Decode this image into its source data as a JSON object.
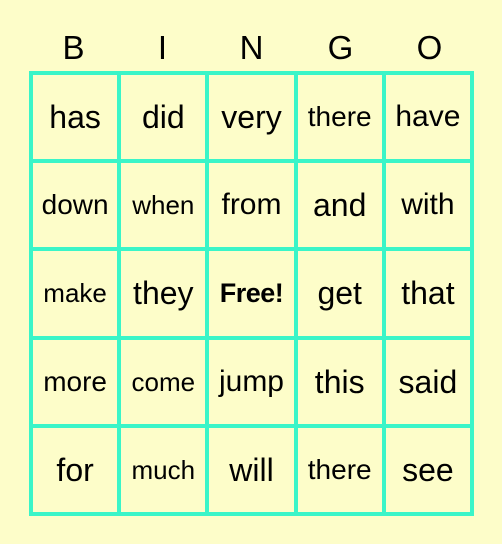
{
  "card": {
    "background_color": "#fdfdc9",
    "border_color": "#3af5c8",
    "header": [
      "B",
      "I",
      "N",
      "G",
      "O"
    ],
    "rows": [
      [
        "has",
        "did",
        "very",
        "there",
        "have"
      ],
      [
        "down",
        "when",
        "from",
        "and",
        "with"
      ],
      [
        "make",
        "they",
        "Free!",
        "get",
        "that"
      ],
      [
        "more",
        "come",
        "jump",
        "this",
        "said"
      ],
      [
        "for",
        "much",
        "will",
        "there",
        "see"
      ]
    ]
  }
}
